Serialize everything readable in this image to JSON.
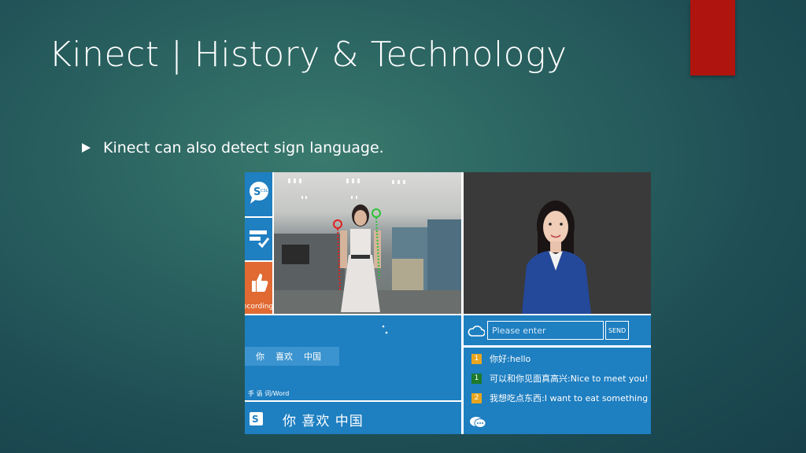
{
  "slide": {
    "title": "Kinect | History & Technology",
    "bullet": "Kinect can also detect sign language.",
    "accent_color": "#b0140f"
  },
  "app": {
    "sidebar": {
      "tile1_icon": "sign-language-bubble-icon",
      "tile2_icon": "message-check-icon",
      "tile3_icon": "hand-thumb-icon",
      "tile3_label": "ecording"
    },
    "recognition": {
      "words": [
        "你",
        "喜欢",
        "中国"
      ],
      "word_label": "手 语 词/Word",
      "sentence": "你 喜欢 中国"
    },
    "chat": {
      "input_placeholder": "Please enter",
      "send_label": "SEND",
      "messages": [
        {
          "num": "1",
          "color": "#e7a51d",
          "text": "你好:hello"
        },
        {
          "num": "1",
          "color": "#1d7a2a",
          "text": "可以和你见面真高兴:Nice to meet you!"
        },
        {
          "num": "2",
          "color": "#e7a51d",
          "text": "我想吃点东西:I want to eat something"
        }
      ]
    },
    "colors": {
      "tile_blue": "#1e7fc1",
      "tile_orange": "#e06a32"
    }
  }
}
